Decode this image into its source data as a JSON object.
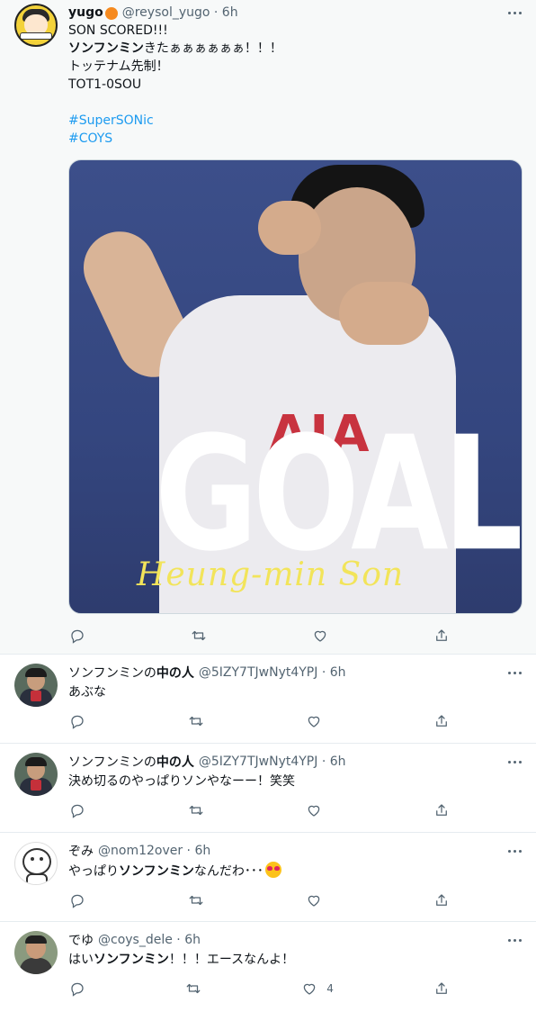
{
  "main_tweet": {
    "name": "yugo",
    "handle": "@reysol_yugo · 6h",
    "text_lines": [
      "SON SCORED!!!",
      "きたぁぁぁぁぁぁ！！！",
      "トッテナム先制！",
      "TOT1-0SOU"
    ],
    "bold_name": "ソンフンミン",
    "hashtags": [
      "#SuperSONic",
      "#COYS"
    ],
    "media": {
      "overlay_big": "GOAL",
      "overlay_script": "Heung-min Son",
      "jersey_text": "AIA"
    },
    "actions": {
      "reply": "",
      "retweet": "",
      "like": "",
      "share": ""
    }
  },
  "replies": [
    {
      "name_plain": "ソンフンミンの",
      "name_bold": "中の人",
      "handle": "@5IZY7TJwNyt4YPJ · 6h",
      "text": "あぶな",
      "likes": ""
    },
    {
      "name_plain": "ソンフンミンの",
      "name_bold": "中の人",
      "handle": "@5IZY7TJwNyt4YPJ · 6h",
      "text": "決め切るのやっぱりソンやなーー！笑笑",
      "likes": ""
    },
    {
      "name_plain": "ぞみ",
      "name_bold": "",
      "handle": "@nom12over · 6h",
      "text_pre": "やっぱり",
      "text_bold": "ソンフンミン",
      "text_post": "なんだわ･･･",
      "likes": ""
    },
    {
      "name_plain": "でゆ",
      "name_bold": "",
      "handle": "@coys_dele · 6h",
      "text_pre": "はい",
      "text_bold": "ソンフンミン",
      "text_post": "！！！エースなんよ！",
      "likes": "4"
    }
  ],
  "colors": {
    "accent": "#1d9bf0",
    "muted": "#536471",
    "text": "#0f1419"
  }
}
